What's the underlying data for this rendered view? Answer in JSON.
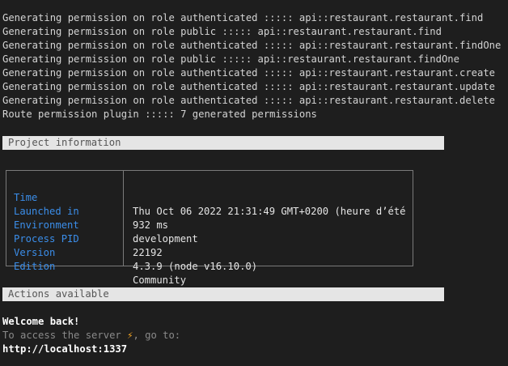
{
  "log_lines": [
    "Generating permission on role authenticated ::::: api::restaurant.restaurant.find",
    "Generating permission on role public ::::: api::restaurant.restaurant.find",
    "Generating permission on role authenticated ::::: api::restaurant.restaurant.findOne",
    "Generating permission on role public ::::: api::restaurant.restaurant.findOne",
    "Generating permission on role authenticated ::::: api::restaurant.restaurant.create",
    "Generating permission on role authenticated ::::: api::restaurant.restaurant.update",
    "Generating permission on role authenticated ::::: api::restaurant.restaurant.delete",
    "Route permission plugin ::::: 7 generated permissions"
  ],
  "project_info": {
    "header": "Project information",
    "rows": [
      {
        "key": "Time",
        "value": "Thu Oct 06 2022 21:31:49 GMT+0200 (heure d’été …"
      },
      {
        "key": "Launched in",
        "value": "932 ms"
      },
      {
        "key": "Environment",
        "value": "development"
      },
      {
        "key": "Process PID",
        "value": "22192"
      },
      {
        "key": "Version",
        "value": "4.3.9 (node v16.10.0)"
      },
      {
        "key": "Edition",
        "value": "Community"
      }
    ]
  },
  "actions": {
    "header": "Actions available",
    "welcome": "Welcome back!",
    "access_prefix": "To access the server ",
    "bolt": "⚡",
    "access_suffix": ", go to:",
    "url": "http://localhost:1337"
  },
  "colors": {
    "background": "#1e1e1e",
    "text": "#d4d4d4",
    "key_blue": "#3b8eea",
    "section_bar": "#e5e5e5",
    "bolt": "#f5a623"
  }
}
